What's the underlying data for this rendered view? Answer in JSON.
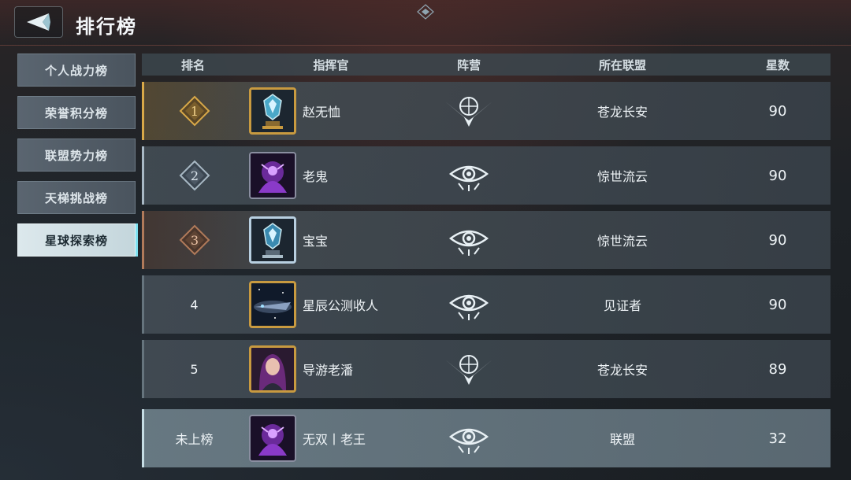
{
  "header": {
    "title": "排行榜"
  },
  "sidebar": {
    "items": [
      {
        "label": "个人战力榜"
      },
      {
        "label": "荣誉积分榜"
      },
      {
        "label": "联盟势力榜"
      },
      {
        "label": "天梯挑战榜"
      },
      {
        "label": "星球探索榜",
        "active": true
      }
    ]
  },
  "table": {
    "headers": {
      "rank": "排名",
      "commander": "指挥官",
      "camp": "阵营",
      "alliance": "所在联盟",
      "stars": "星数"
    },
    "rows": [
      {
        "rank": "1",
        "name": "赵无恤",
        "camp_icon": "globe-wings-emblem",
        "alliance": "苍龙长安",
        "stars": "90",
        "avatar": "trophy-gold"
      },
      {
        "rank": "2",
        "name": "老鬼",
        "camp_icon": "eye-emblem",
        "alliance": "惊世流云",
        "stars": "90",
        "avatar": "purple-character"
      },
      {
        "rank": "3",
        "name": "宝宝",
        "camp_icon": "eye-emblem",
        "alliance": "惊世流云",
        "stars": "90",
        "avatar": "trophy-silver"
      },
      {
        "rank": "4",
        "name": "星辰公测收人",
        "camp_icon": "eye-emblem",
        "alliance": "见证者",
        "stars": "90",
        "avatar": "spaceship"
      },
      {
        "rank": "5",
        "name": "导游老潘",
        "camp_icon": "globe-wings-emblem",
        "alliance": "苍龙长安",
        "stars": "89",
        "avatar": "woman-portrait"
      }
    ],
    "self_row": {
      "rank": "未上榜",
      "name": "无双丨老王",
      "camp_icon": "eye-emblem",
      "alliance": "联盟",
      "stars": "32",
      "avatar": "purple-character"
    }
  },
  "colors": {
    "gold": "#d8a848",
    "silver": "#a8b8c4",
    "bronze": "#b07a5a",
    "active_tab": "#dce8ec",
    "accent_cyan": "#7ee0f0"
  }
}
